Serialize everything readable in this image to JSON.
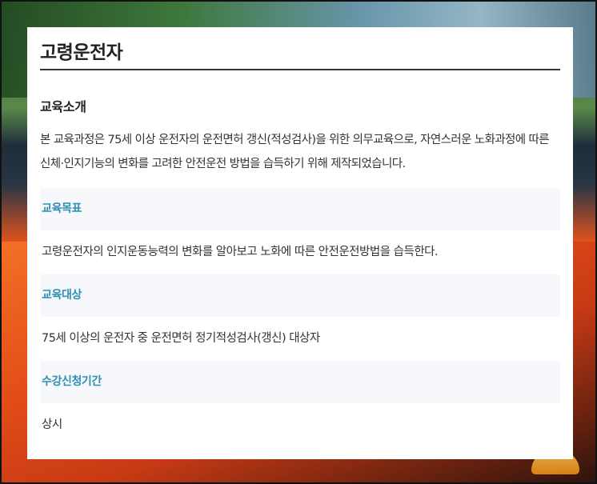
{
  "page": {
    "title": "고령운전자"
  },
  "intro": {
    "heading": "교육소개",
    "text": "본 교육과정은 75세 이상 운전자의 운전면허 갱신(적성검사)을 위한 의무교육으로, 자연스러운 노화과정에 따른 신체·인지기능의 변화를 고려한 안전운전 방법을 습득하기 위해 제작되었습니다."
  },
  "info": [
    {
      "label": "교육목표",
      "value": "고령운전자의 인지운동능력의 변화를 알아보고 노화에 따른 안전운전방법을 습득한다."
    },
    {
      "label": "교육대상",
      "value": "75세 이상의 운전자 중 운전면허 정기적성검사(갱신) 대상자"
    },
    {
      "label": "수강신청기간",
      "value": "상시"
    }
  ],
  "colors": {
    "accent": "#2e8fb3",
    "info_bg": "#f6f8fb"
  }
}
